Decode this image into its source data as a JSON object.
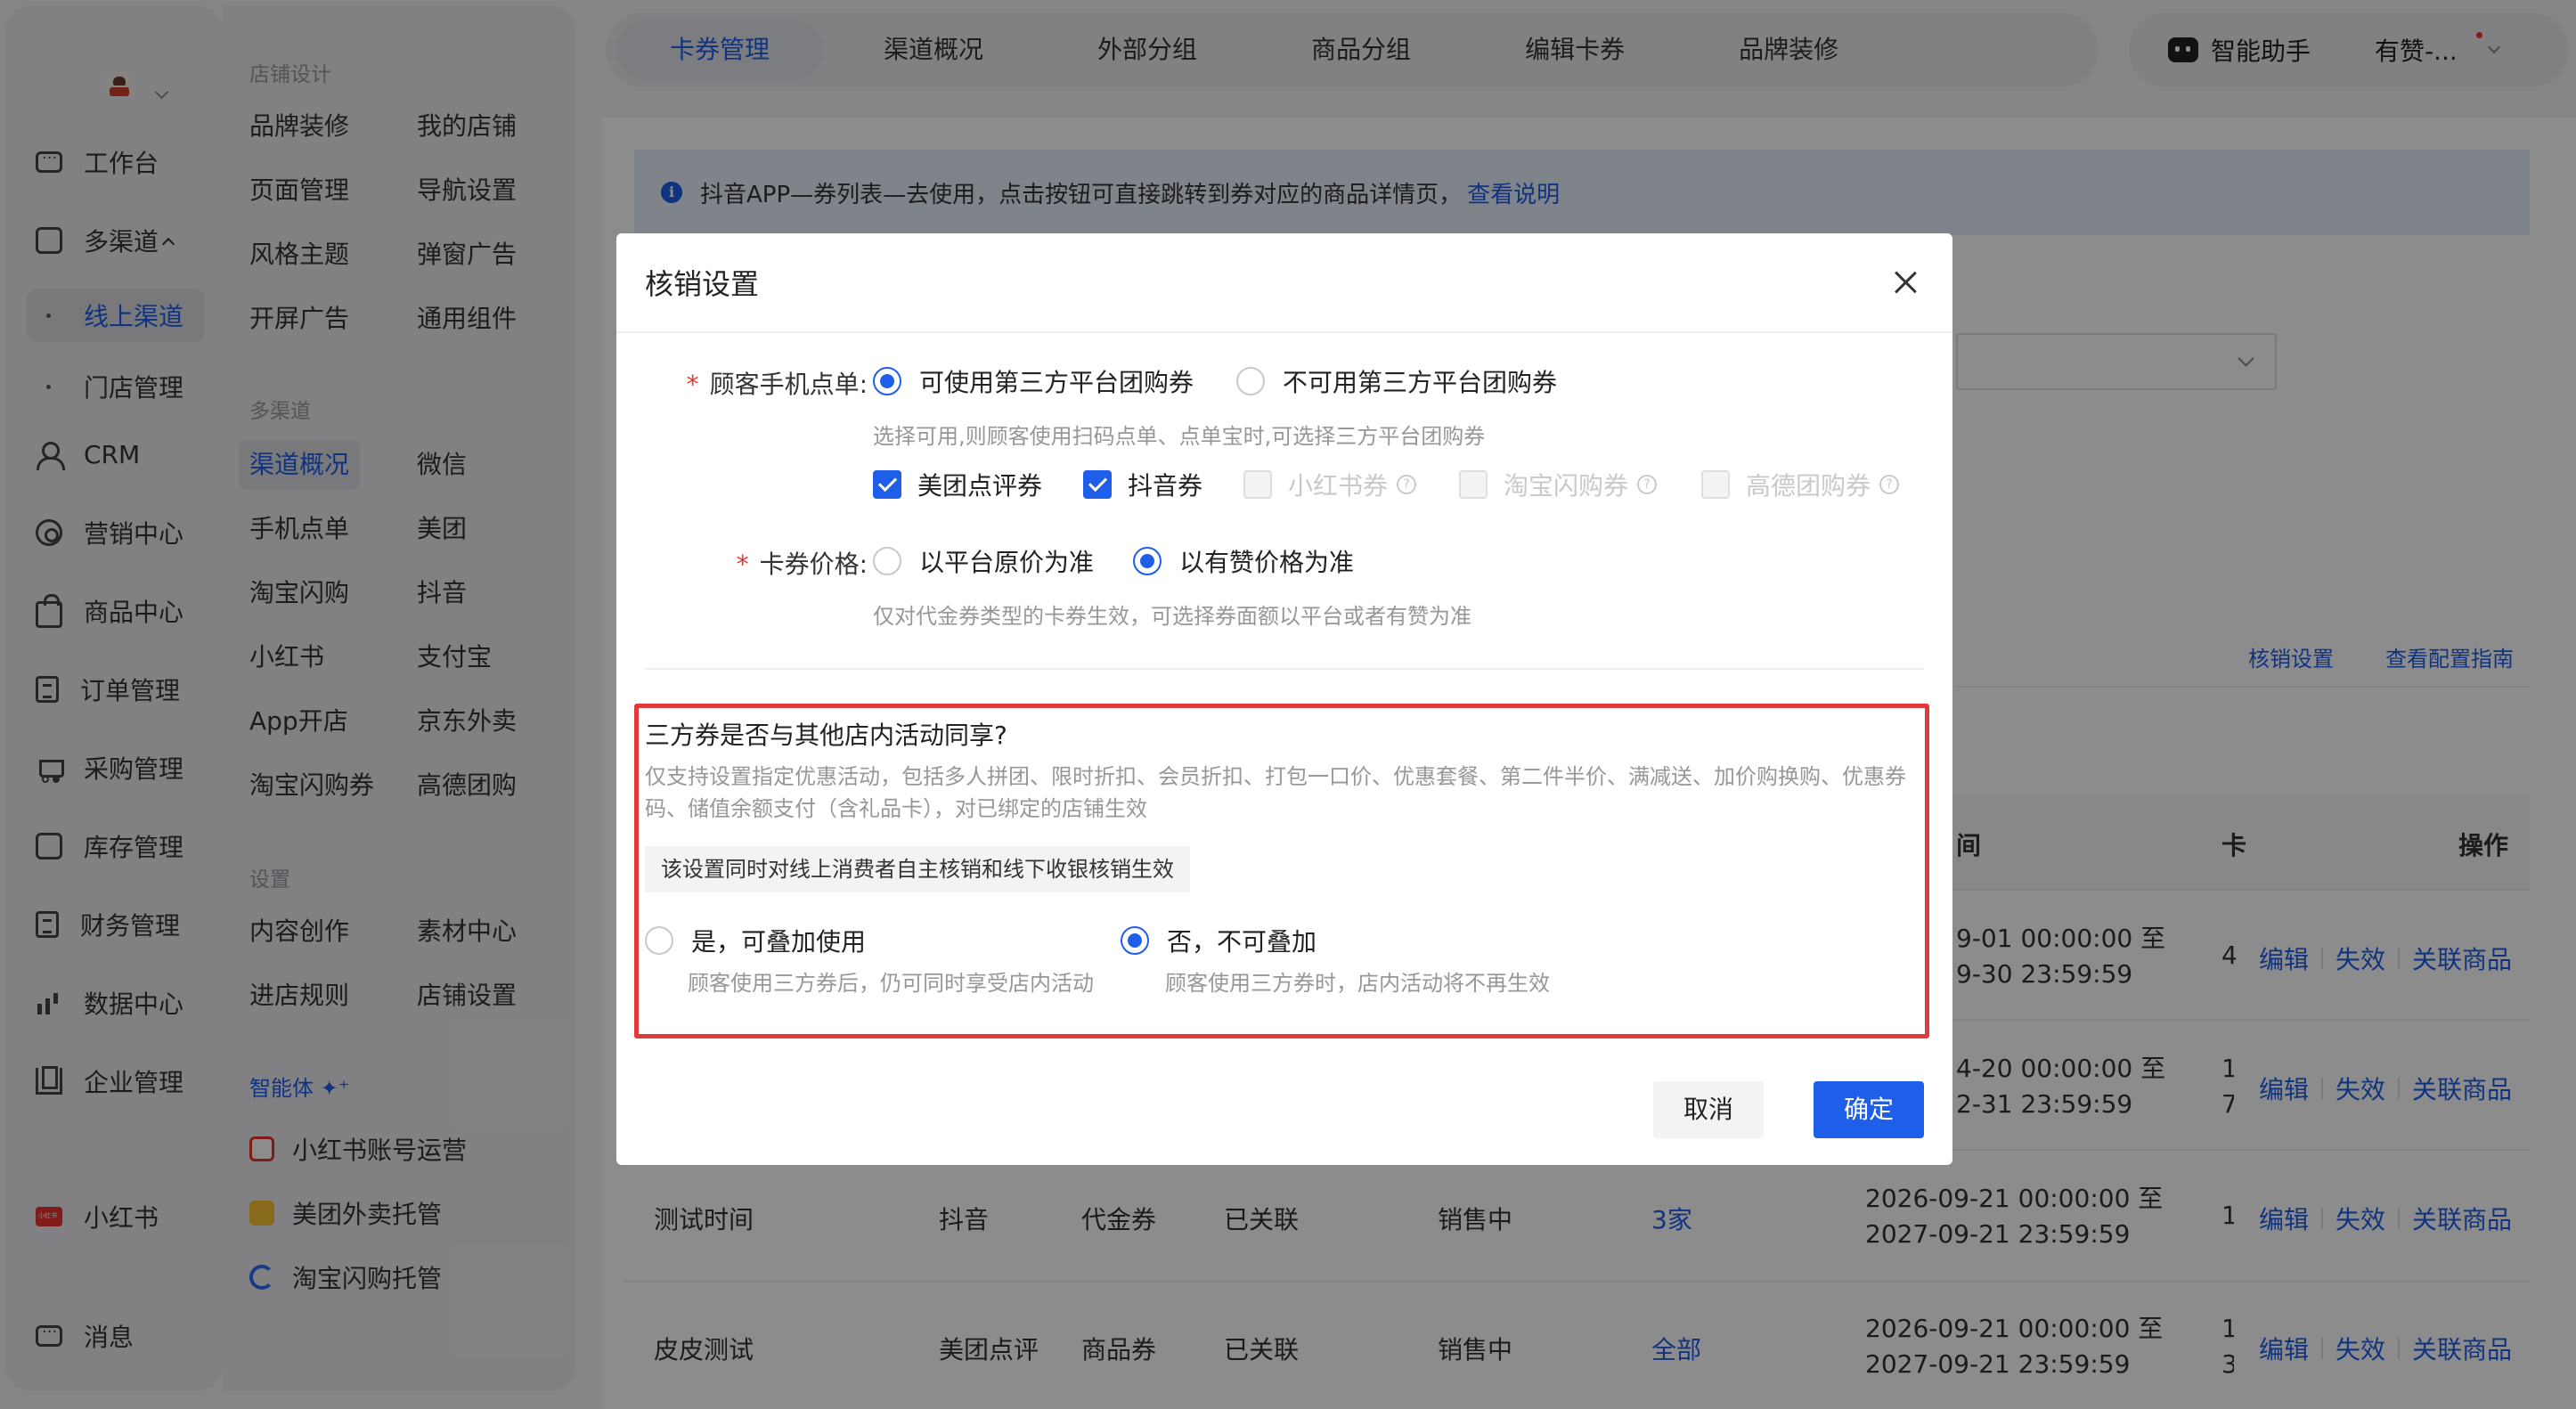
{
  "sidebar": {
    "items": [
      {
        "label": "工作台",
        "icon": "workbench-icon"
      },
      {
        "label": "多渠道",
        "icon": "store-icon"
      },
      {
        "label": "线上渠道",
        "icon": "dot-icon"
      },
      {
        "label": "门店管理",
        "icon": "dot-icon"
      },
      {
        "label": "CRM",
        "icon": "person-icon"
      },
      {
        "label": "营销中心",
        "icon": "target-icon"
      },
      {
        "label": "商品中心",
        "icon": "bag-icon"
      },
      {
        "label": "订单管理",
        "icon": "doc-icon"
      },
      {
        "label": "采购管理",
        "icon": "cart-icon"
      },
      {
        "label": "库存管理",
        "icon": "warehouse-icon"
      },
      {
        "label": "财务管理",
        "icon": "finance-icon"
      },
      {
        "label": "数据中心",
        "icon": "bars-icon"
      },
      {
        "label": "企业管理",
        "icon": "building-icon"
      },
      {
        "label": "小红书",
        "icon": "xiaohongshu-icon"
      },
      {
        "label": "消息",
        "icon": "message-icon"
      }
    ]
  },
  "subnav": {
    "store_design": {
      "title": "店铺设计",
      "items": [
        "品牌装修",
        "我的店铺",
        "页面管理",
        "导航设置",
        "风格主题",
        "弹窗广告",
        "开屏广告",
        "通用组件"
      ]
    },
    "multichannel": {
      "title": "多渠道",
      "items": [
        "渠道概况",
        "微信",
        "手机点单",
        "美团",
        "淘宝闪购",
        "抖音",
        "小红书",
        "支付宝",
        "App开店",
        "京东外卖",
        "淘宝闪购券",
        "高德团购"
      ]
    },
    "settings": {
      "title": "设置",
      "items": [
        "内容创作",
        "素材中心",
        "进店规则",
        "店铺设置"
      ]
    },
    "agents": {
      "title": "智能体 ✦⁺",
      "items": [
        "小红书账号运营",
        "美团外卖托管",
        "淘宝闪购托管"
      ]
    }
  },
  "topbar": {
    "tabs": [
      "卡券管理",
      "渠道概况",
      "外部分组",
      "商品分组",
      "编辑卡券",
      "品牌装修"
    ],
    "assistant": "智能助手",
    "store": "有赞-..."
  },
  "notice": {
    "text": "抖音APP—券列表—去使用，点击按钮可直接跳转到券对应的商品详情页，",
    "link": "查看说明"
  },
  "background": {
    "links": [
      "核销设置",
      "查看配置指南"
    ],
    "headers": [
      "间",
      "卡",
      "操作"
    ],
    "rows": [
      {
        "name": "",
        "platform": "",
        "type": "",
        "link": "",
        "status": "",
        "stores": "",
        "time1": "9-01 00:00:00 至",
        "time2": "9-30 23:59:59",
        "stock": "4"
      },
      {
        "name": "",
        "platform": "",
        "type": "",
        "link": "",
        "status": "",
        "stores": "",
        "time1": "4-20 00:00:00 至",
        "time2": "2-31 23:59:59",
        "stock": "1\n7"
      },
      {
        "name": "测试时间",
        "platform": "抖音",
        "type": "代金券",
        "link": "已关联",
        "status": "销售中",
        "stores": "3家",
        "time1": "2026-09-21 00:00:00 至",
        "time2": "2027-09-21 23:59:59",
        "stock": "1"
      },
      {
        "name": "皮皮测试",
        "platform": "美团点评",
        "type": "商品券",
        "link": "已关联",
        "status": "销售中",
        "stores": "全部",
        "time1": "2026-09-21 00:00:00 至",
        "time2": "2027-09-21 23:59:59",
        "stock": "1\n3"
      }
    ],
    "ops": [
      "编辑",
      "失效",
      "关联商品"
    ]
  },
  "modal": {
    "title": "核销设置",
    "order": {
      "label": "顾客手机点单:",
      "options": [
        "可使用第三方平台团购券",
        "不可用第三方平台团购券"
      ],
      "selected": 0,
      "hint": "选择可用,则顾客使用扫码点单、点单宝时,可选择三方平台团购券",
      "platforms": [
        {
          "label": "美团点评券",
          "checked": true,
          "disabled": false
        },
        {
          "label": "抖音券",
          "checked": true,
          "disabled": false
        },
        {
          "label": "小红书券",
          "checked": false,
          "disabled": true
        },
        {
          "label": "淘宝闪购券",
          "checked": false,
          "disabled": true
        },
        {
          "label": "高德团购券",
          "checked": false,
          "disabled": true
        }
      ]
    },
    "price": {
      "label": "卡券价格:",
      "options": [
        "以平台原价为准",
        "以有赞价格为准"
      ],
      "selected": 1,
      "hint": "仅对代金券类型的卡券生效，可选择券面额以平台或者有赞为准"
    },
    "share": {
      "question": "三方券是否与其他店内活动同享?",
      "desc": "仅支持设置指定优惠活动，包括多人拼团、限时折扣、会员折扣、打包一口价、优惠套餐、第二件半价、满减送、加价购换购、优惠券码、储值余额支付（含礼品卡），对已绑定的店铺生效",
      "tag": "该设置同时对线上消费者自主核销和线下收银核销生效",
      "options": [
        {
          "label": "是，可叠加使用",
          "hint": "顾客使用三方券后，仍可同时享受店内活动"
        },
        {
          "label": "否，不可叠加",
          "hint": "顾客使用三方券时，店内活动将不再生效"
        }
      ],
      "selected": 1
    },
    "cancel": "取消",
    "confirm": "确定"
  },
  "colors": {
    "accent": "#1f5ee8",
    "highlight_border": "#e2393d"
  }
}
